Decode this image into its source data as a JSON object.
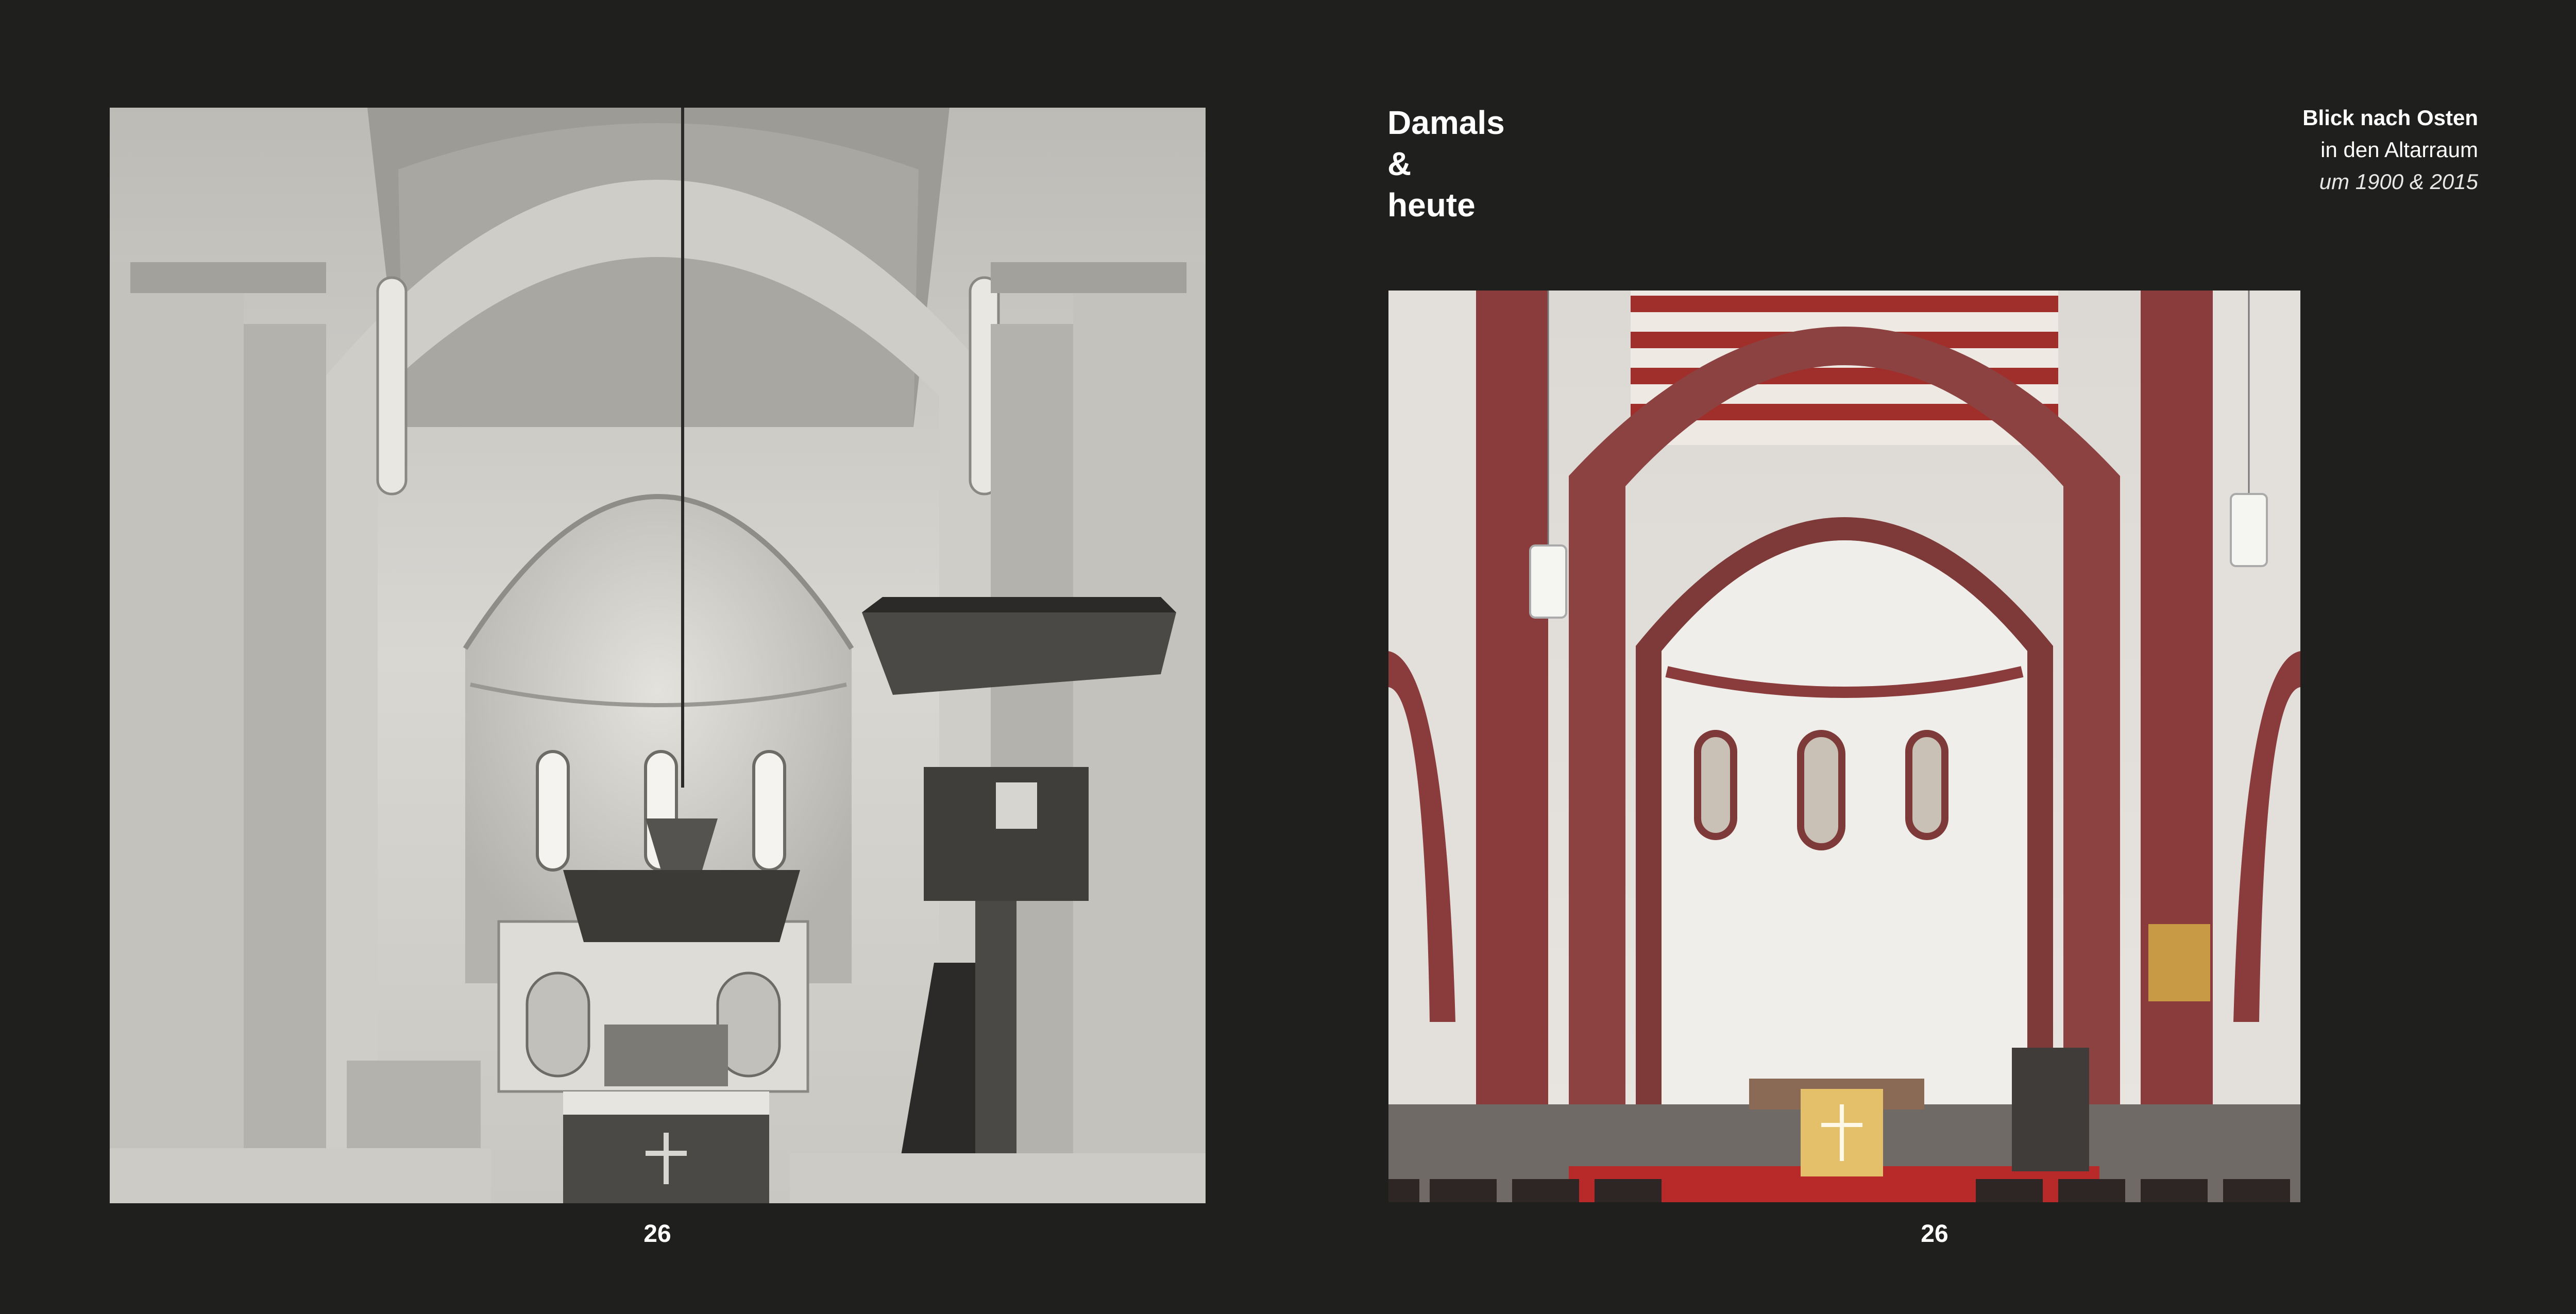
{
  "spread": {
    "background": "#1f1f1e",
    "heading": [
      "Damals",
      "&",
      "heute"
    ],
    "caption": {
      "line1": "Blick nach Osten",
      "line2": "in den Altarraum",
      "line3": "um 1900 & 2015"
    },
    "page_number_left": "26",
    "page_number_right": "26"
  },
  "photos": {
    "then": {
      "era": "um 1900",
      "colors": [
        "#d8d6d0",
        "#8c8a85",
        "#2b2a28"
      ]
    },
    "now": {
      "era": "2015",
      "colors": [
        "#e6e2de",
        "#8a3c3c",
        "#b82a2a"
      ]
    }
  }
}
